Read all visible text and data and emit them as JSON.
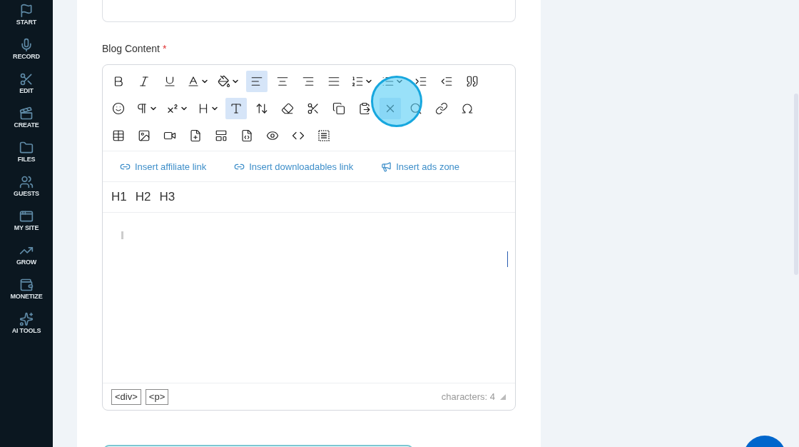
{
  "sidebar": {
    "items": [
      {
        "label": "START"
      },
      {
        "label": "RECORD"
      },
      {
        "label": "EDIT"
      },
      {
        "label": "CREATE"
      },
      {
        "label": "FILES"
      },
      {
        "label": "GUESTS"
      },
      {
        "label": "MY SITE"
      },
      {
        "label": "GROW"
      },
      {
        "label": "MONETIZE"
      },
      {
        "label": "AI TOOLS"
      }
    ]
  },
  "editor": {
    "label": "Blog Content",
    "required_mark": "*",
    "toolbar": [
      [
        {
          "selected": false,
          "dropdown": false
        },
        {
          "selected": false,
          "dropdown": false
        },
        {
          "selected": false,
          "dropdown": false
        },
        {
          "selected": false,
          "dropdown": true
        },
        {
          "selected": false,
          "dropdown": true
        },
        {
          "selected": true,
          "dropdown": false
        },
        {
          "selected": false,
          "dropdown": false
        },
        {
          "selected": false,
          "dropdown": false
        },
        {
          "selected": false,
          "dropdown": false
        },
        {
          "selected": false,
          "dropdown": true
        },
        {
          "selected": false,
          "dropdown": true
        },
        {
          "selected": false,
          "dropdown": false
        },
        {
          "selected": false,
          "dropdown": false
        },
        {
          "selected": false,
          "dropdown": false
        }
      ],
      [
        {
          "selected": false,
          "dropdown": false
        },
        {
          "selected": false,
          "dropdown": true
        },
        {
          "selected": false,
          "dropdown": true
        },
        {
          "selected": false,
          "dropdown": true
        },
        {
          "selected": true,
          "dropdown": false
        },
        {
          "selected": false,
          "dropdown": false
        },
        {
          "selected": false,
          "dropdown": false
        },
        {
          "selected": false,
          "dropdown": false
        },
        {
          "selected": false,
          "dropdown": false
        },
        {
          "selected": false,
          "dropdown": false
        },
        {
          "selected": true,
          "dropdown": false
        },
        {
          "selected": false,
          "dropdown": false
        },
        {
          "selected": false,
          "dropdown": false
        },
        {
          "selected": false,
          "dropdown": false
        }
      ],
      [
        {
          "selected": false,
          "dropdown": false
        },
        {
          "selected": false,
          "dropdown": false
        },
        {
          "selected": false,
          "dropdown": false
        },
        {
          "selected": false,
          "dropdown": false
        },
        {
          "selected": false,
          "dropdown": false
        },
        {
          "selected": false,
          "dropdown": false
        },
        {
          "selected": false,
          "dropdown": false
        },
        {
          "selected": false,
          "dropdown": false
        },
        {
          "selected": false,
          "dropdown": false
        }
      ]
    ],
    "insert_links": [
      {
        "kind": "link",
        "label": "Insert affiliate link"
      },
      {
        "kind": "link",
        "label": "Insert downloadables link"
      },
      {
        "kind": "ads",
        "label": "Insert ads zone"
      }
    ],
    "headings": [
      "H1",
      "H2",
      "H3"
    ],
    "path": [
      "<div>",
      "<p>"
    ],
    "character_count": "characters: 4"
  }
}
